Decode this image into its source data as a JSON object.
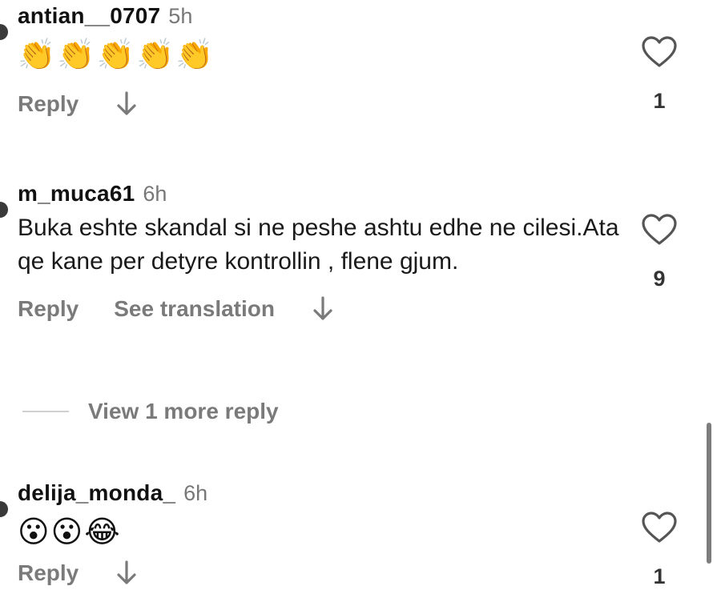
{
  "comments": [
    {
      "username": "antian__0707",
      "time": "5h",
      "emojis": "👏👏👏👏👏",
      "actions": {
        "reply": "Reply"
      },
      "like_count": "1",
      "icons": {
        "like": "heart-icon",
        "replies": "arrow-down-icon"
      }
    },
    {
      "username": "m_muca61",
      "time": "6h",
      "text": "Buka eshte skandal si ne peshe ashtu edhe ne cilesi.Ata qe kane per detyre kontrollin , flene gjum.",
      "actions": {
        "reply": "Reply",
        "translate": "See translation"
      },
      "like_count": "9",
      "view_more": "View 1 more reply",
      "icons": {
        "like": "heart-icon",
        "replies": "arrow-down-icon"
      }
    },
    {
      "username": "delija_monda_",
      "time": "6h",
      "emojis": "😮😮😂",
      "actions": {
        "reply": "Reply"
      },
      "like_count": "1",
      "icons": {
        "like": "heart-icon",
        "replies": "arrow-down-icon"
      }
    }
  ],
  "colors": {
    "secondary_text": "#7a7a7a",
    "scrollbar": "#7d7d7d"
  }
}
